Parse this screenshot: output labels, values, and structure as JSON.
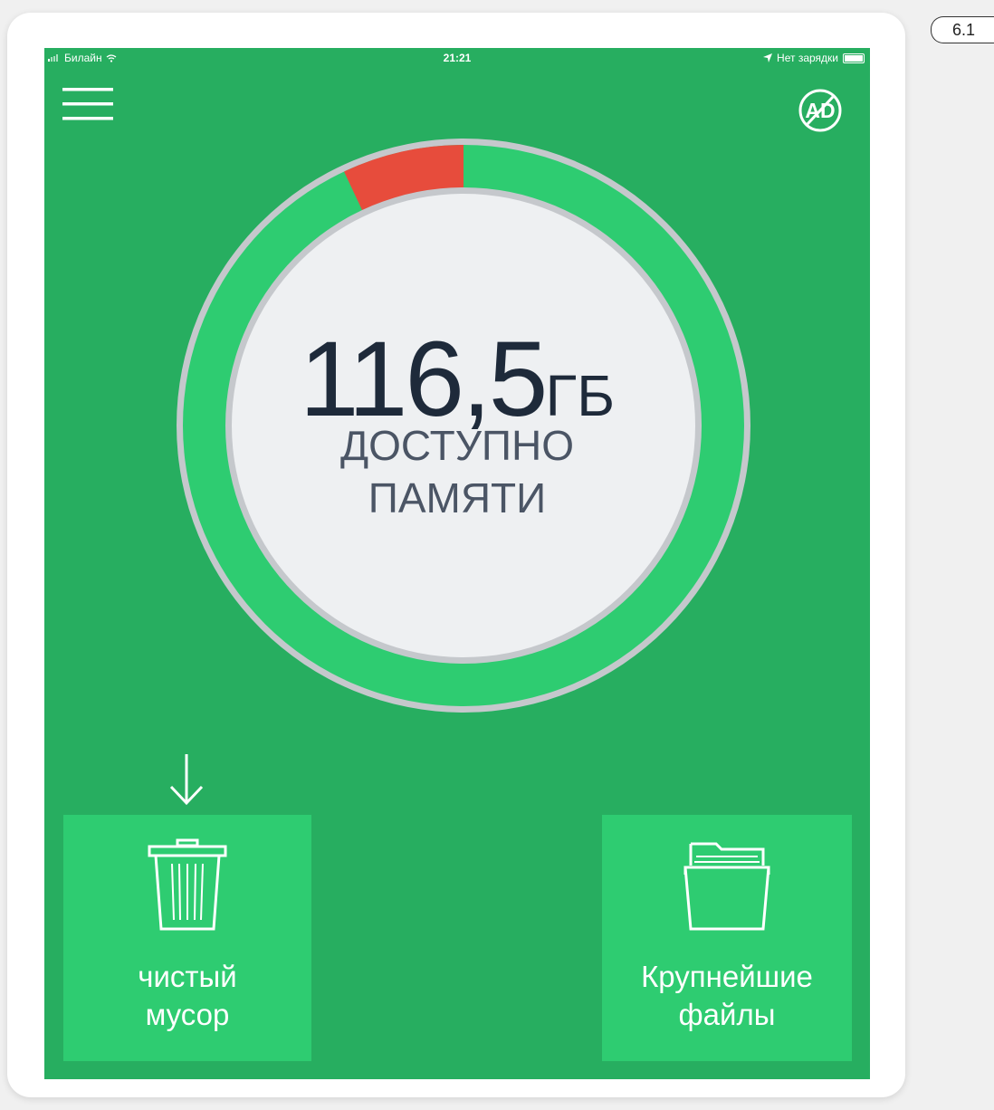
{
  "figure_label": "6.1",
  "status_bar": {
    "carrier": "Билайн",
    "time": "21:21",
    "charging_status": "Нет зарядки"
  },
  "storage": {
    "value": "116,5",
    "unit": "ГБ",
    "caption_line1": "ДОСТУПНО",
    "caption_line2": "ПАМЯТИ",
    "used_fraction_red": 0.07
  },
  "tiles": {
    "left": {
      "label_line1": "чистый",
      "label_line2": "мусор",
      "icon": "trash-can-icon"
    },
    "right": {
      "label_line1": "Крупнейшие",
      "label_line2": "файлы",
      "icon": "folder-icon"
    }
  },
  "colors": {
    "background_green": "#27ae60",
    "tile_green": "#2ecc71",
    "ring_green": "#2ecc71",
    "ring_red": "#e74c3c",
    "ring_border_gray": "#c5c8cc",
    "inner_circle": "#eef0f2"
  }
}
